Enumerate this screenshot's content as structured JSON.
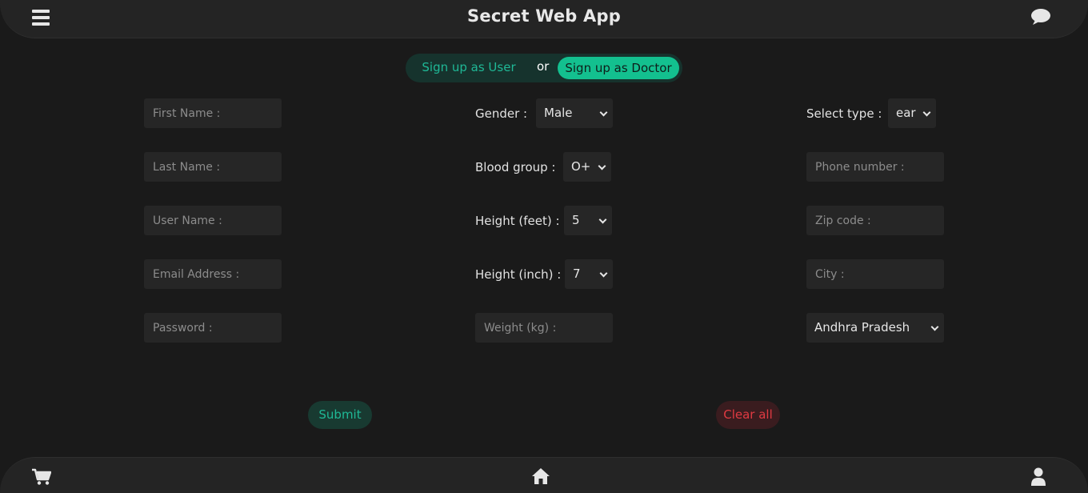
{
  "header": {
    "title": "Secret Web App"
  },
  "toggle": {
    "user_label": "Sign up as User",
    "or": "or",
    "doctor_label": "Sign up as Doctor"
  },
  "form": {
    "first_name_placeholder": "First Name :",
    "last_name_placeholder": "Last Name :",
    "user_name_placeholder": "User Name :",
    "email_placeholder": "Email Address :",
    "password_placeholder": "Password :",
    "gender_label": "Gender :",
    "gender_value": "Male",
    "blood_group_label": "Blood group :",
    "blood_group_value": "O+",
    "height_feet_label": "Height (feet) :",
    "height_feet_value": "5",
    "height_inch_label": "Height (inch) :",
    "height_inch_value": "7",
    "weight_placeholder": "Weight (kg) :",
    "type_label": "Select type :",
    "type_value": "ear",
    "phone_placeholder": "Phone number :",
    "zip_placeholder": "Zip code :",
    "city_placeholder": "City :",
    "state_value": "Andhra Pradesh"
  },
  "actions": {
    "submit_label": "Submit",
    "clear_label": "Clear all"
  },
  "icons": {
    "menu": "hamburger-menu-icon",
    "chat": "chat-bubble-icon",
    "cart": "shopping-cart-icon",
    "home": "home-icon",
    "user": "user-icon"
  },
  "colors": {
    "accent": "#13c08f",
    "accent_text": "#1fb896",
    "danger": "#e03a42",
    "background": "#1a1a1a",
    "bar": "#242424"
  }
}
